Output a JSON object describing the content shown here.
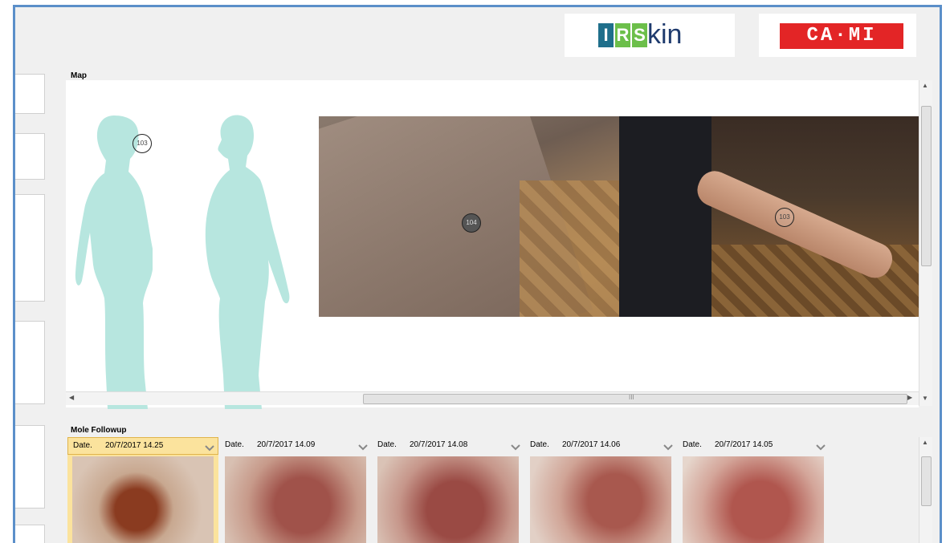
{
  "branding": {
    "irs_letters": [
      "I",
      "R",
      "S"
    ],
    "irs_suffix": "kin",
    "cami_text": "CA·MI"
  },
  "colors": {
    "frame_border": "#5b8fc9",
    "silhouette": "#b7e6df",
    "selected_card": "#fbe39d",
    "irs_block_1": "#1f6f8b",
    "irs_block_2": "#6cbf4a",
    "irs_block_3": "#6cbf4a",
    "cami_red": "#e32526"
  },
  "map": {
    "label": "Map",
    "markers": [
      {
        "id": "silhouette-marker",
        "text": "103"
      },
      {
        "id": "closeup-marker",
        "text": "104"
      },
      {
        "id": "overview-marker",
        "text": "103"
      }
    ],
    "scrollbar_grip": "III"
  },
  "followup": {
    "label": "Mole Followup",
    "date_label": "Date.",
    "entries": [
      {
        "date": "20/7/2017 14.25",
        "selected": true
      },
      {
        "date": "20/7/2017 14.09",
        "selected": false
      },
      {
        "date": "20/7/2017 14.08",
        "selected": false
      },
      {
        "date": "20/7/2017 14.06",
        "selected": false
      },
      {
        "date": "20/7/2017 14.05",
        "selected": false
      }
    ]
  }
}
